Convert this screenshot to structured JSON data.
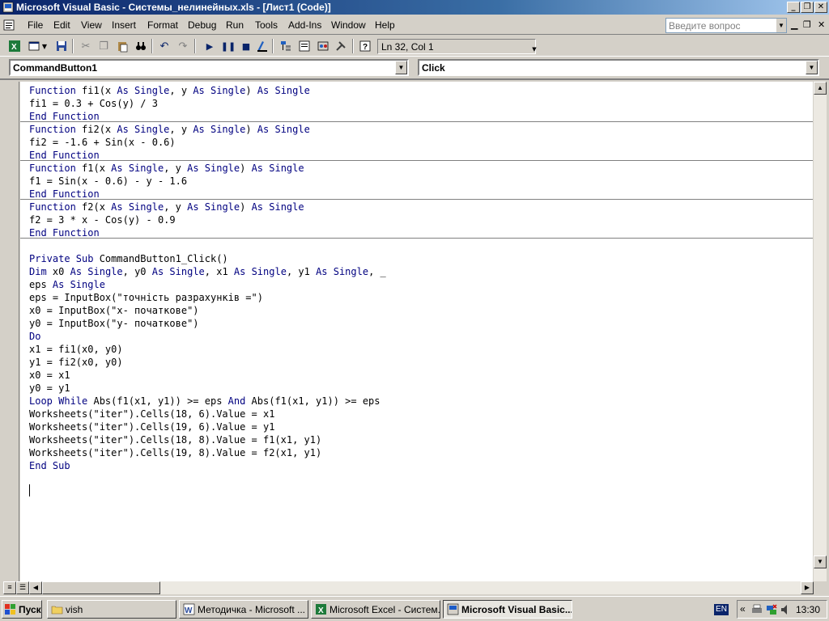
{
  "window": {
    "title": "Microsoft Visual Basic - Системы_нелинейных.xls - [Лист1 (Code)]",
    "minimize": "_",
    "restore": "❐",
    "close": "✕"
  },
  "menu": {
    "items": [
      "File",
      "Edit",
      "View",
      "Insert",
      "Format",
      "Debug",
      "Run",
      "Tools",
      "Add-Ins",
      "Window",
      "Help"
    ],
    "ask_placeholder": "Введите вопрос"
  },
  "toolbar": {
    "position": "Ln 32, Col 1"
  },
  "object_combo": "CommandButton1",
  "procedure_combo": "Click",
  "code": {
    "blocks": [
      {
        "lines": [
          [
            [
              "kw",
              "Function"
            ],
            [
              "t",
              " fi1(x "
            ],
            [
              "kw",
              "As Single"
            ],
            [
              "t",
              ", y "
            ],
            [
              "kw",
              "As Single"
            ],
            [
              "t",
              ") "
            ],
            [
              "kw",
              "As Single"
            ]
          ],
          [
            [
              "t",
              "fi1 = 0.3 + Cos(y) / 3"
            ]
          ],
          [
            [
              "kw",
              "End Function"
            ]
          ]
        ]
      },
      {
        "lines": [
          [
            [
              "kw",
              "Function"
            ],
            [
              "t",
              " fi2(x "
            ],
            [
              "kw",
              "As Single"
            ],
            [
              "t",
              ", y "
            ],
            [
              "kw",
              "As Single"
            ],
            [
              "t",
              ") "
            ],
            [
              "kw",
              "As Single"
            ]
          ],
          [
            [
              "t",
              "fi2 = -1.6 + Sin(x - 0.6)"
            ]
          ],
          [
            [
              "kw",
              "End Function"
            ]
          ]
        ]
      },
      {
        "lines": [
          [
            [
              "kw",
              "Function"
            ],
            [
              "t",
              " f1(x "
            ],
            [
              "kw",
              "As Single"
            ],
            [
              "t",
              ", y "
            ],
            [
              "kw",
              "As Single"
            ],
            [
              "t",
              ") "
            ],
            [
              "kw",
              "As Single"
            ]
          ],
          [
            [
              "t",
              "f1 = Sin(x - 0.6) - y - 1.6"
            ]
          ],
          [
            [
              "kw",
              "End Function"
            ]
          ]
        ]
      },
      {
        "lines": [
          [
            [
              "kw",
              "Function"
            ],
            [
              "t",
              " f2(x "
            ],
            [
              "kw",
              "As Single"
            ],
            [
              "t",
              ", y "
            ],
            [
              "kw",
              "As Single"
            ],
            [
              "t",
              ") "
            ],
            [
              "kw",
              "As Single"
            ]
          ],
          [
            [
              "t",
              "f2 = 3 * x - Cos(y) - 0.9"
            ]
          ],
          [
            [
              "kw",
              "End Function"
            ]
          ]
        ]
      },
      {
        "lines": [
          [
            [
              "t",
              ""
            ]
          ],
          [
            [
              "kw",
              "Private Sub"
            ],
            [
              "t",
              " CommandButton1_Click()"
            ]
          ],
          [
            [
              "kw",
              "Dim"
            ],
            [
              "t",
              " x0 "
            ],
            [
              "kw",
              "As Single"
            ],
            [
              "t",
              ", y0 "
            ],
            [
              "kw",
              "As Single"
            ],
            [
              "t",
              ", x1 "
            ],
            [
              "kw",
              "As Single"
            ],
            [
              "t",
              ", y1 "
            ],
            [
              "kw",
              "As Single"
            ],
            [
              "t",
              ", _"
            ]
          ],
          [
            [
              "t",
              "eps "
            ],
            [
              "kw",
              "As Single"
            ]
          ],
          [
            [
              "t",
              "eps = InputBox(\"точність разрахунків =\")"
            ]
          ],
          [
            [
              "t",
              "x0 = InputBox(\"x- початкове\")"
            ]
          ],
          [
            [
              "t",
              "y0 = InputBox(\"y- початкове\")"
            ]
          ],
          [
            [
              "kw",
              "Do"
            ]
          ],
          [
            [
              "t",
              "x1 = fi1(x0, y0)"
            ]
          ],
          [
            [
              "t",
              "y1 = fi2(x0, y0)"
            ]
          ],
          [
            [
              "t",
              "x0 = x1"
            ]
          ],
          [
            [
              "t",
              "y0 = y1"
            ]
          ],
          [
            [
              "kw",
              "Loop While"
            ],
            [
              "t",
              " Abs(f1(x1, y1)) >= eps "
            ],
            [
              "kw",
              "And"
            ],
            [
              "t",
              " Abs(f1(x1, y1)) >= eps"
            ]
          ],
          [
            [
              "t",
              "Worksheets(\"iter\").Cells(18, 6).Value = x1"
            ]
          ],
          [
            [
              "t",
              "Worksheets(\"iter\").Cells(19, 6).Value = y1"
            ]
          ],
          [
            [
              "t",
              "Worksheets(\"iter\").Cells(18, 8).Value = f1(x1, y1)"
            ]
          ],
          [
            [
              "t",
              "Worksheets(\"iter\").Cells(19, 8).Value = f2(x1, y1)"
            ]
          ],
          [
            [
              "kw",
              "End Sub"
            ]
          ]
        ]
      }
    ]
  },
  "taskbar": {
    "start": "Пуск",
    "tasks": [
      {
        "label": "vish",
        "icon": "folder-icon"
      },
      {
        "label": "Методичка - Microsoft ...",
        "icon": "word-icon"
      },
      {
        "label": "Microsoft Excel - Систем...",
        "icon": "excel-icon"
      },
      {
        "label": "Microsoft Visual Basic...",
        "icon": "vb-icon",
        "active": true
      }
    ],
    "lang": "EN",
    "tray_arrow": "«",
    "clock": "13:30"
  }
}
